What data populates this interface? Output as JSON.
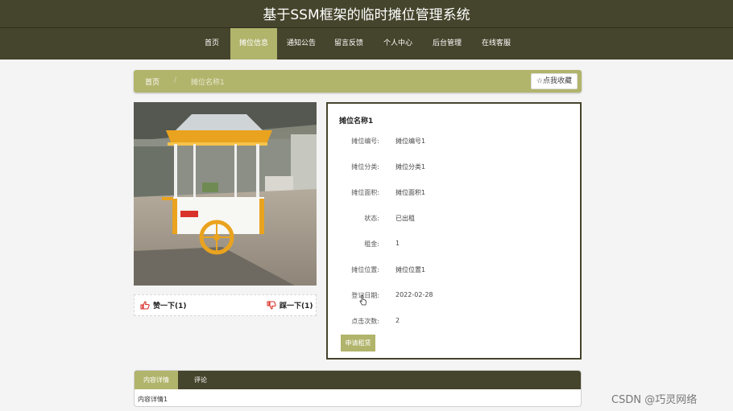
{
  "header": {
    "title": "基于SSM框架的临时摊位管理系统",
    "nav": [
      {
        "label": "首页",
        "active": false
      },
      {
        "label": "摊位信息",
        "active": true
      },
      {
        "label": "通知公告",
        "active": false
      },
      {
        "label": "留言反馈",
        "active": false
      },
      {
        "label": "个人中心",
        "active": false
      },
      {
        "label": "后台管理",
        "active": false
      },
      {
        "label": "在线客服",
        "active": false
      }
    ]
  },
  "breadcrumb": {
    "home": "首页",
    "separator": "/",
    "current": "摊位名称1",
    "favorite_label": "☆点我收藏"
  },
  "votes": {
    "like_label": "赞一下(1)",
    "dislike_label": "踩一下(1)"
  },
  "detail": {
    "name": "摊位名称1",
    "fields": [
      {
        "label": "摊位编号:",
        "value": "摊位编号1"
      },
      {
        "label": "摊位分类:",
        "value": "摊位分类1"
      },
      {
        "label": "摊位面积:",
        "value": "摊位面积1"
      },
      {
        "label": "状态:",
        "value": "已出租"
      },
      {
        "label": "租金:",
        "value": "1"
      },
      {
        "label": "摊位位置:",
        "value": "摊位位置1"
      },
      {
        "label": "登记日期:",
        "value": "2022-02-28"
      },
      {
        "label": "点击次数:",
        "value": "2"
      }
    ],
    "apply_label": "申请租赁"
  },
  "tabs": {
    "items": [
      "内容详情",
      "评论"
    ],
    "active_index": 0,
    "content": "内容详情1"
  },
  "watermark": "CSDN @巧灵网络",
  "colors": {
    "header_bg": "#45442c",
    "accent": "#b1b46b",
    "page_bg": "#f4f4f4"
  }
}
